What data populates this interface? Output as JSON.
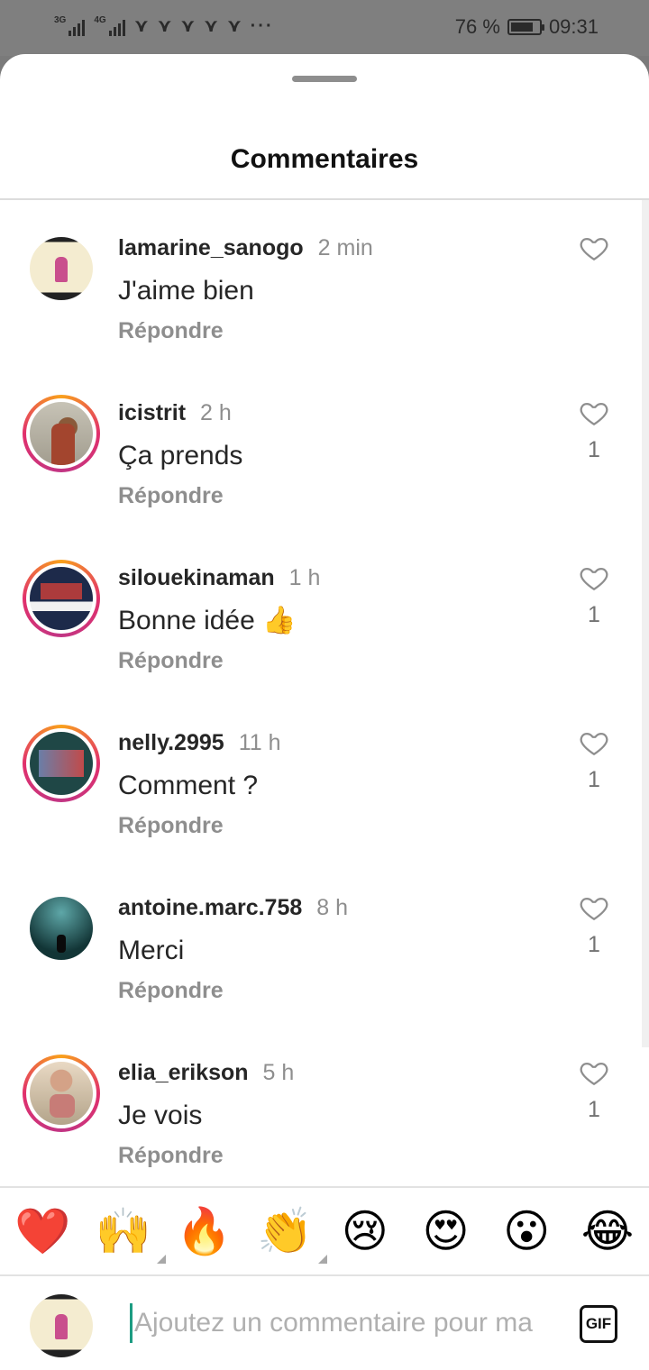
{
  "status_bar": {
    "signal_1_label": "3G",
    "signal_2_label": "4G",
    "battery_percent_text": "76 %",
    "time": "09:31",
    "notif_icons": "⋎ ⋎ ⋎ ⋎ ⋎ ···"
  },
  "sheet": {
    "title": "Commentaires"
  },
  "comments": [
    {
      "username": "lamarine_sanogo",
      "time": "2 min",
      "text": "J'aime bien",
      "reply_label": "Répondre",
      "like_count": "",
      "has_story": false
    },
    {
      "username": "icistrit",
      "time": "2 h",
      "text": "Ça prends",
      "reply_label": "Répondre",
      "like_count": "1",
      "has_story": true
    },
    {
      "username": "silouekinaman",
      "time": "1 h",
      "text": "Bonne idée 👍",
      "reply_label": "Répondre",
      "like_count": "1",
      "has_story": true
    },
    {
      "username": "nelly.2995",
      "time": "11 h",
      "text": "Comment ?",
      "reply_label": "Répondre",
      "like_count": "1",
      "has_story": true
    },
    {
      "username": "antoine.marc.758",
      "time": "8 h",
      "text": "Merci",
      "reply_label": "Répondre",
      "like_count": "1",
      "has_story": false
    },
    {
      "username": "elia_erikson",
      "time": "5 h",
      "text": "Je vois",
      "reply_label": "Répondre",
      "like_count": "1",
      "has_story": true
    }
  ],
  "emoji_bar": [
    "❤️",
    "🙌",
    "🔥",
    "👏",
    "😢",
    "😍",
    "😮",
    "😂"
  ],
  "composer": {
    "placeholder": "Ajoutez un commentaire pour ma",
    "value": "",
    "gif_label": "GIF"
  },
  "colors": {
    "story_ring": "#e1306c",
    "text_primary": "#262626",
    "text_secondary": "#8e8e8e",
    "cursor": "#1c9c82"
  }
}
